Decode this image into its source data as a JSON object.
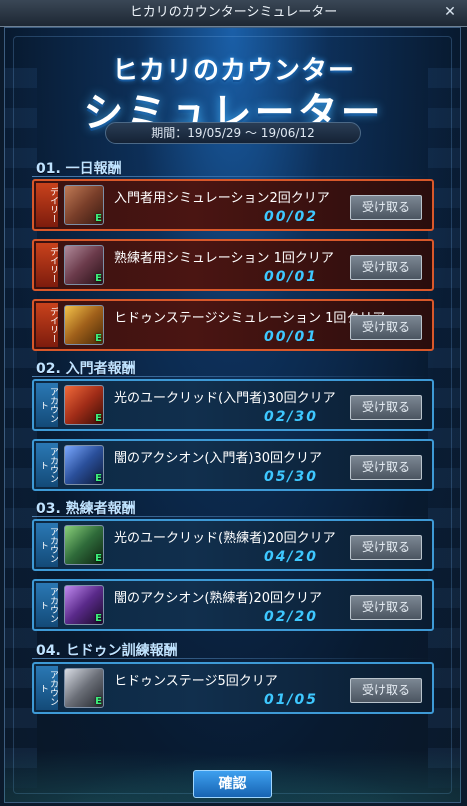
{
  "window": {
    "title": "ヒカリのカウンターシミュレーター",
    "close_icon": "close-icon"
  },
  "header": {
    "title_line1": "ヒカリのカウンター",
    "title_line2": "シミュレーター",
    "period": "期間：19/05/29 ～ 19/06/12"
  },
  "sections": [
    {
      "label": "01. 一日報酬"
    },
    {
      "label": "02. 入門者報酬"
    },
    {
      "label": "03. 熟練者報酬"
    },
    {
      "label": "04. ヒドゥン訓練報酬"
    }
  ],
  "missions": [
    {
      "tag": "デイリー",
      "type": "daily",
      "icon": "chest-icon",
      "icon_color": "#7a3f2a",
      "text": "入門者用シミュレーション2回クリア",
      "progress": "00/02",
      "button": "受け取る"
    },
    {
      "tag": "デイリー",
      "type": "daily",
      "icon": "chest-icon",
      "icon_color": "#6a3a4a",
      "text": "熟練者用シミュレーション 1回クリア",
      "progress": "00/01",
      "button": "受け取る"
    },
    {
      "tag": "デイリー",
      "type": "daily",
      "icon": "golden-chest-icon",
      "icon_color": "#a0601a",
      "text": "ヒドゥンステージシミュレーション 1回クリア",
      "progress": "00/01",
      "button": "受け取る"
    },
    {
      "tag": "アカウント",
      "type": "account",
      "icon": "red-chest-icon",
      "icon_color": "#a22d18",
      "text": "光のユークリッド(入門者)30回クリア",
      "progress": "02/30",
      "button": "受け取る"
    },
    {
      "tag": "アカウント",
      "type": "account",
      "icon": "blue-chest-icon",
      "icon_color": "#2a4f9a",
      "text": "闇のアクシオン(入門者)30回クリア",
      "progress": "05/30",
      "button": "受け取る"
    },
    {
      "tag": "アカウント",
      "type": "account",
      "icon": "green-chest-icon",
      "icon_color": "#2f6b3a",
      "text": "光のユークリッド(熟練者)20回クリア",
      "progress": "04/20",
      "button": "受け取る"
    },
    {
      "tag": "アカウント",
      "type": "account",
      "icon": "purple-chest-icon",
      "icon_color": "#5a2a8a",
      "text": "闇のアクシオン(熟練者)20回クリア",
      "progress": "02/20",
      "button": "受け取る"
    },
    {
      "tag": "アカウント",
      "type": "account",
      "icon": "silver-chest-icon",
      "icon_color": "#6b6f78",
      "text": "ヒドゥンステージ5回クリア",
      "progress": "01/05",
      "button": "受け取る"
    }
  ],
  "icon_badge": "E",
  "footer": {
    "confirm": "確認"
  }
}
